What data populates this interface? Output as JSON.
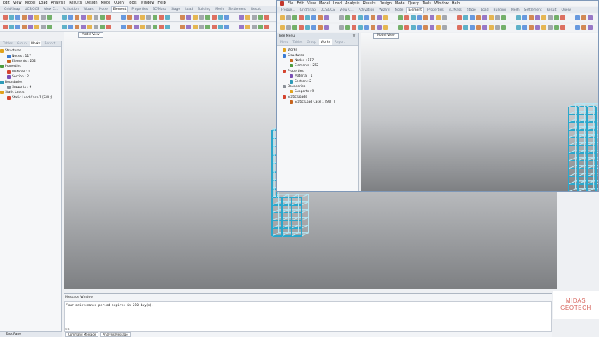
{
  "back_window": {
    "menu": [
      "Edit",
      "View",
      "Model",
      "Load",
      "Analysis",
      "Results",
      "Design",
      "Mode",
      "Query",
      "Tools",
      "Window",
      "Help"
    ],
    "tabs": [
      "Grid/Snap",
      "UCS/GCS",
      "View C...",
      "Activation",
      "Wizard",
      "Node",
      "Element",
      "Properties",
      "BC/Mass",
      "Stage",
      "Load",
      "Building",
      "Mesh",
      "Settlement",
      "Result"
    ],
    "active_tab": "Element",
    "side_tabs": [
      "Tables",
      "Group",
      "Works",
      "Report"
    ],
    "active_side_tab": "Works",
    "tree": [
      "Structures",
      "Nodes : 117",
      "Elements : 252",
      "Properties",
      "Material : 1",
      "Section : 2",
      "Boundaries",
      "Supports : 9",
      "Static Loads",
      "Static Load Case 1 [SW ;]"
    ],
    "viewport_tab": "Model View",
    "bottom_left": "Task Pane"
  },
  "front_window": {
    "menu": [
      "File",
      "Edit",
      "View",
      "Model",
      "Load",
      "Analysis",
      "Results",
      "Design",
      "Mode",
      "Query",
      "Tools",
      "Window",
      "Help"
    ],
    "tabs": [
      "Freque...",
      "Grid/Snap",
      "UCS/GCS",
      "View C...",
      "Activation",
      "Wizard",
      "Node",
      "Element",
      "Properties",
      "BC/Mass",
      "Stage",
      "Load",
      "Building",
      "Mesh",
      "Settlement",
      "Result",
      "Query"
    ],
    "active_tab": "Element",
    "tree_title": "Tree Menu",
    "side_tabs": [
      "Menu",
      "Tables",
      "Group",
      "Works",
      "Report"
    ],
    "active_side_tab": "Works",
    "tree": [
      "Works",
      "Structures",
      "Nodes : 117",
      "Elements : 252",
      "Properties",
      "Material : 1",
      "Section : 2",
      "Boundaries",
      "Supports : 9",
      "Static Loads",
      "Static Load Case 1 [SW ;]"
    ],
    "viewport_tab": "Model View"
  },
  "message_window": {
    "title": "Message Window",
    "text": "Your maintenance period expires in 210 day(s).",
    "prompt": ">>",
    "tabs": [
      "Command Message",
      "Analysis Message"
    ]
  },
  "logo": {
    "line1": "MIDAS",
    "line2": "GEOTECH"
  },
  "colors": {
    "frame": "#2aa7cc",
    "joint": "#b6e6f3",
    "logo": "#d86a62"
  }
}
